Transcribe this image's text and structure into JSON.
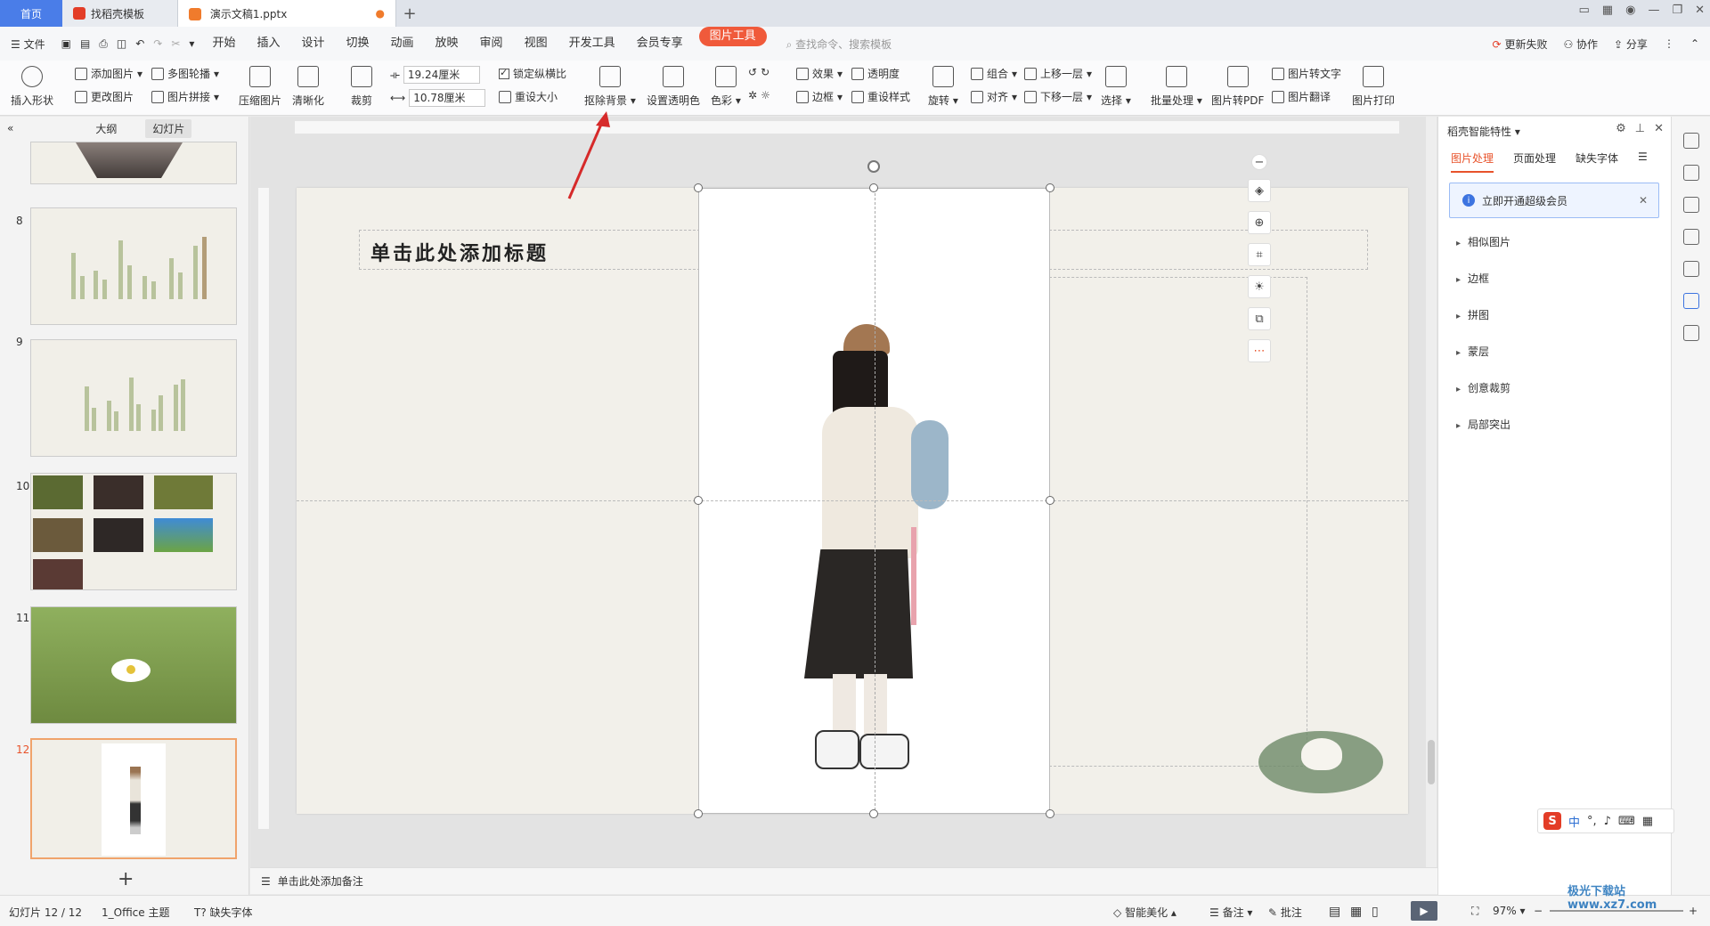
{
  "tabs": {
    "home": "首页",
    "template": "找稻壳模板",
    "doc": "演示文稿1.pptx"
  },
  "menu": {
    "file": "文件",
    "items": [
      "开始",
      "插入",
      "设计",
      "切换",
      "动画",
      "放映",
      "审阅",
      "视图",
      "开发工具",
      "会员专享"
    ],
    "active": "图片工具",
    "search": "查找命令、搜索模板",
    "update_fail": "更新失败",
    "collab": "协作",
    "share": "分享"
  },
  "ribbon": {
    "insert_shape": "插入形状",
    "add_image": "添加图片",
    "change_image": "更改图片",
    "multi_outline": "多图轮播",
    "image_splice": "图片拼接",
    "compress": "压缩图片",
    "sharpen": "清晰化",
    "crop": "裁剪",
    "width": "19.24厘米",
    "height": "10.78厘米",
    "lock_ratio": "锁定纵横比",
    "reset_size": "重设大小",
    "remove_bg": "抠除背景",
    "set_transparent": "设置透明色",
    "color": "色彩",
    "effect": "效果",
    "border": "边框",
    "transparency": "透明度",
    "reset_style": "重设样式",
    "rotate": "旋转",
    "group": "组合",
    "align": "对齐",
    "bring_forward": "上移一层",
    "send_backward": "下移一层",
    "select": "选择",
    "batch": "批量处理",
    "to_pdf": "图片转PDF",
    "to_text": "图片转文字",
    "translate": "图片翻译",
    "print": "图片打印"
  },
  "left_panel": {
    "tab_outline": "大纲",
    "tab_slides": "幻灯片",
    "slide_numbers": [
      "8",
      "9",
      "10",
      "11",
      "12"
    ]
  },
  "slide": {
    "title_placeholder": "单击此处添加标题"
  },
  "notes": {
    "placeholder": "单击此处添加备注"
  },
  "right_panel": {
    "title": "稻壳智能特性",
    "tabs": [
      "图片处理",
      "页面处理",
      "缺失字体"
    ],
    "vip_banner": "立即开通超级会员",
    "items": [
      "相似图片",
      "边框",
      "拼图",
      "蒙层",
      "创意裁剪",
      "局部突出"
    ]
  },
  "statusbar": {
    "slide_info": "幻灯片 12 / 12",
    "theme": "1_Office 主题",
    "missing_font": "缺失字体",
    "beautify": "智能美化",
    "notes": "备注",
    "comment": "批注",
    "zoom": "97%"
  },
  "ime": {
    "lang": "中"
  },
  "watermark": "极光下载站 www.xz7.com"
}
